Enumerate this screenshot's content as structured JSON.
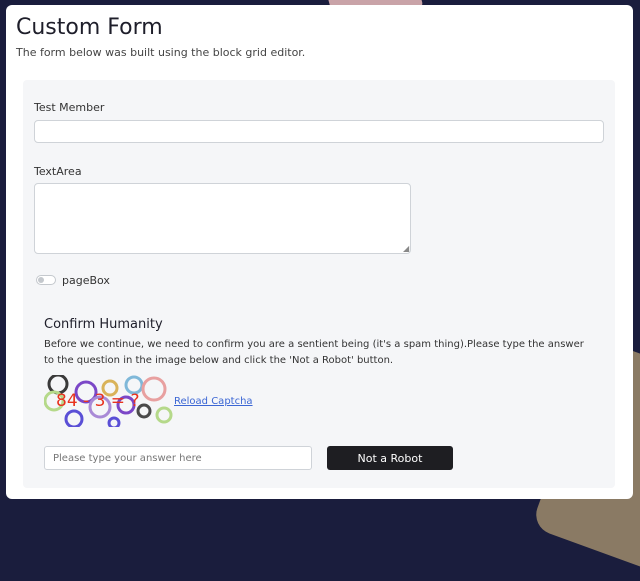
{
  "header": {
    "title": "Custom Form",
    "subtitle": "The form below was built using the block grid editor."
  },
  "form": {
    "member_label": "Test Member",
    "member_value": "",
    "textarea_label": "TextArea",
    "textarea_value": "",
    "pagebox_label": "pageBox",
    "pagebox_checked": false
  },
  "captcha": {
    "title": "Confirm Humanity",
    "description": "Before we continue, we need to confirm you are a sentient being (it's a spam thing).Please type the answer to the question in the image below and click the 'Not a Robot' button.",
    "image_text": "84 - 3 = ?",
    "reload_label": "Reload Captcha",
    "answer_placeholder": "Please type your answer here",
    "submit_label": "Not a Robot"
  },
  "colors": {
    "backdrop": "#1a1d3d",
    "panel": "#f5f6f8",
    "button": "#1e1e22",
    "link": "#3b66d4",
    "captcha_text": "#e8321e"
  }
}
